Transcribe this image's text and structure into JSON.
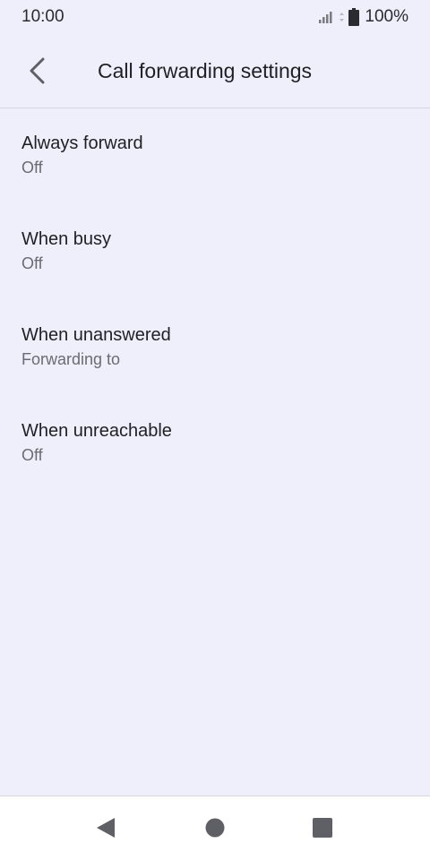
{
  "status_bar": {
    "time": "10:00",
    "battery": "100%",
    "icons": [
      "signal-icon",
      "data-arrows-icon",
      "battery-icon"
    ]
  },
  "app_bar": {
    "title": "Call forwarding settings",
    "back_icon": "back-arrow-icon"
  },
  "items": [
    {
      "title": "Always forward",
      "summary": "Off"
    },
    {
      "title": "When busy",
      "summary": "Off"
    },
    {
      "title": "When unanswered",
      "summary": "Forwarding to"
    },
    {
      "title": "When unreachable",
      "summary": "Off"
    }
  ],
  "nav_bar": {
    "icons": [
      "nav-back-icon",
      "nav-home-icon",
      "nav-recents-icon"
    ]
  },
  "colors": {
    "background": "#efeffb",
    "nav_background": "#ffffff",
    "primary_text": "#1f1f24",
    "secondary_text": "#6b6b73",
    "icon": "#5f5f66"
  }
}
